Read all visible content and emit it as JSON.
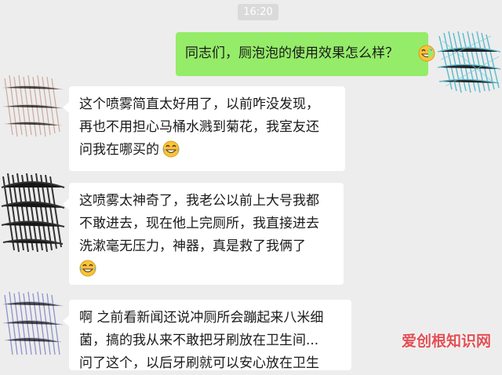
{
  "chat": {
    "timestamp": "16:20",
    "messages": [
      {
        "sender": "self",
        "lines": [
          "同志们，厕泡泡的使用效果怎么样？"
        ],
        "emoji": "grinning-sweat-emoji",
        "avatar_color": "#4fb6c8"
      },
      {
        "sender": "other",
        "lines": [
          "这个喷雾简直太好用了，以前咋没发现，",
          "再也不用担心马桶水溅到菊花，我室友还",
          "问我在哪买的"
        ],
        "emoji": "tears-of-joy-emoji",
        "avatar_color": "#c9a99c"
      },
      {
        "sender": "other",
        "lines": [
          "这喷雾太神奇了，我老公以前上大号我都",
          "不敢进去，现在他上完厕所，我直接进去",
          "洗漱毫无压力，神器，真是救了我俩了"
        ],
        "emoji": "tears-of-joy-emoji",
        "avatar_color": "#2b2b2b"
      },
      {
        "sender": "other",
        "lines": [
          "啊  之前看新闻还说冲厕所会蹦起来八米细",
          "菌，搞的我从来不敢把牙刷放在卫生间...",
          "问了这个，以后牙刷就可以安心放在卫生"
        ],
        "avatar_color": "#8a90c8"
      }
    ]
  },
  "watermark": {
    "text": "爱创根知识网",
    "color": "#e0484e"
  }
}
